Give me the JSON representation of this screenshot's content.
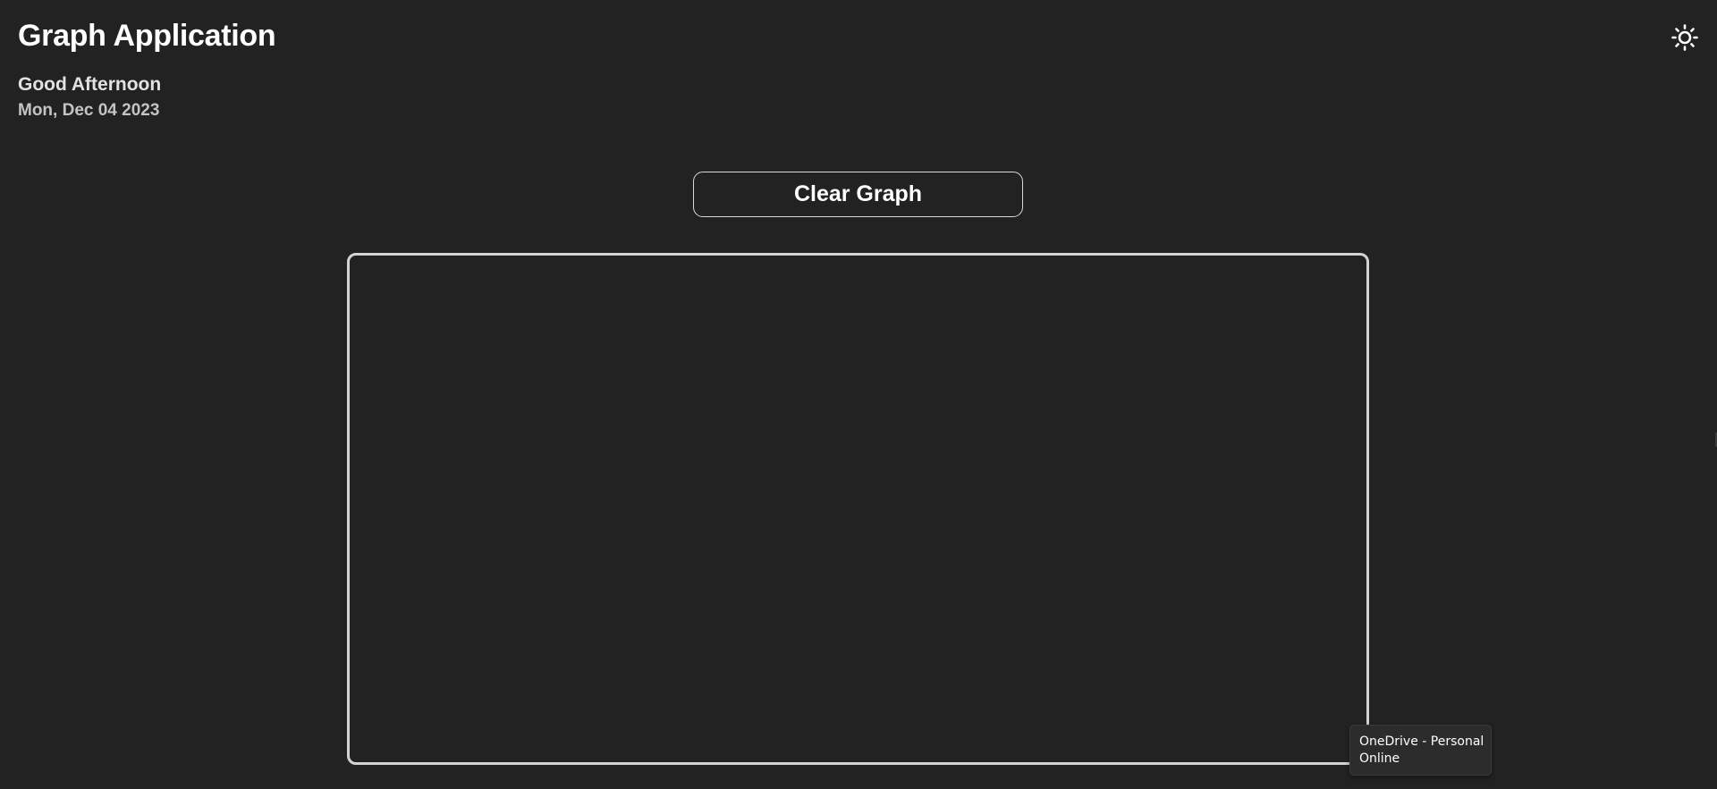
{
  "header": {
    "title": "Graph Application",
    "greeting": "Good Afternoon",
    "date": "Mon, Dec 04 2023"
  },
  "theme_toggle": {
    "icon": "sun-icon"
  },
  "toolbar": {
    "clear_label": "Clear Graph"
  },
  "tooltip": {
    "line1": "OneDrive - Personal",
    "line2": "Online"
  },
  "colors": {
    "background": "#222222",
    "canvas_border": "#d3d3d3",
    "button_border": "#d9d9d9",
    "text": "#ffffff"
  }
}
